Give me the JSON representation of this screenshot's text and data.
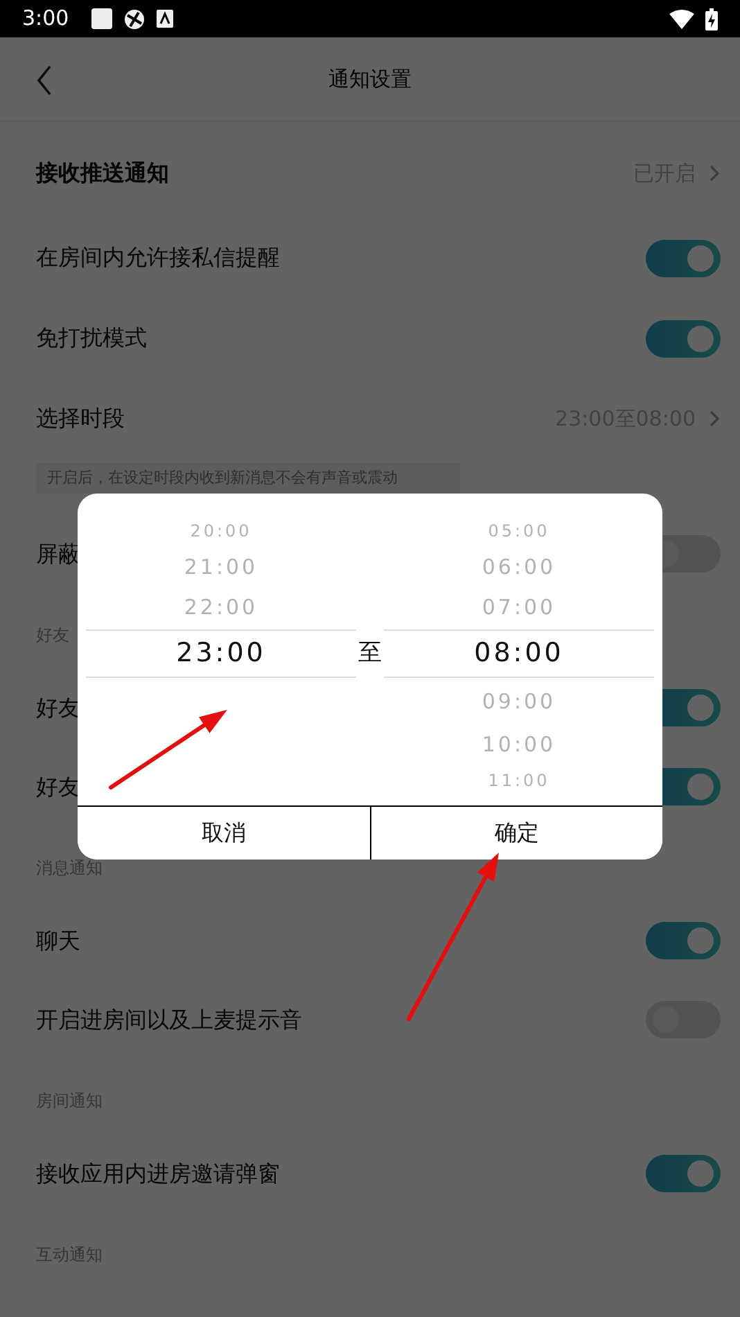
{
  "status_bar": {
    "time": "3:00"
  },
  "header": {
    "title": "通知设置"
  },
  "settings": [
    {
      "kind": "link",
      "label": "接收推送通知",
      "value": "已开启"
    },
    {
      "kind": "toggle",
      "label": "在房间内允许接私信提醒",
      "on": true
    },
    {
      "kind": "toggle",
      "label": "免打扰模式",
      "on": true
    },
    {
      "kind": "link",
      "label": "选择时段",
      "value": "23:00至08:00"
    },
    {
      "kind": "hint",
      "label": "开启后，在设定时段内收到新消息不会有声音或震动"
    },
    {
      "kind": "toggle",
      "label": "屏蔽",
      "on": false
    },
    {
      "kind": "section",
      "label": "好友"
    },
    {
      "kind": "toggle",
      "label": "好友",
      "on": true
    },
    {
      "kind": "toggle",
      "label": "好友",
      "on": true
    },
    {
      "kind": "section",
      "label": "消息通知"
    },
    {
      "kind": "toggle",
      "label": "聊天",
      "on": true
    },
    {
      "kind": "toggle",
      "label": "开启进房间以及上麦提示音",
      "on": false
    },
    {
      "kind": "section",
      "label": "房间通知"
    },
    {
      "kind": "toggle",
      "label": "接收应用内进房邀请弹窗",
      "on": true
    },
    {
      "kind": "section",
      "label": "互动通知"
    }
  ],
  "dialog": {
    "start_times": [
      {
        "text": "20:00",
        "selected": false
      },
      {
        "text": "21:00",
        "selected": false
      },
      {
        "text": "22:00",
        "selected": false
      },
      {
        "text": "23:00",
        "selected": true
      }
    ],
    "separator": "至",
    "end_times": [
      {
        "text": "05:00",
        "selected": false
      },
      {
        "text": "06:00",
        "selected": false
      },
      {
        "text": "07:00",
        "selected": false
      },
      {
        "text": "08:00",
        "selected": true
      },
      {
        "text": "09:00",
        "selected": false
      },
      {
        "text": "10:00",
        "selected": false
      },
      {
        "text": "11:00",
        "selected": false
      }
    ],
    "buttons": [
      "取消",
      "确定"
    ]
  }
}
